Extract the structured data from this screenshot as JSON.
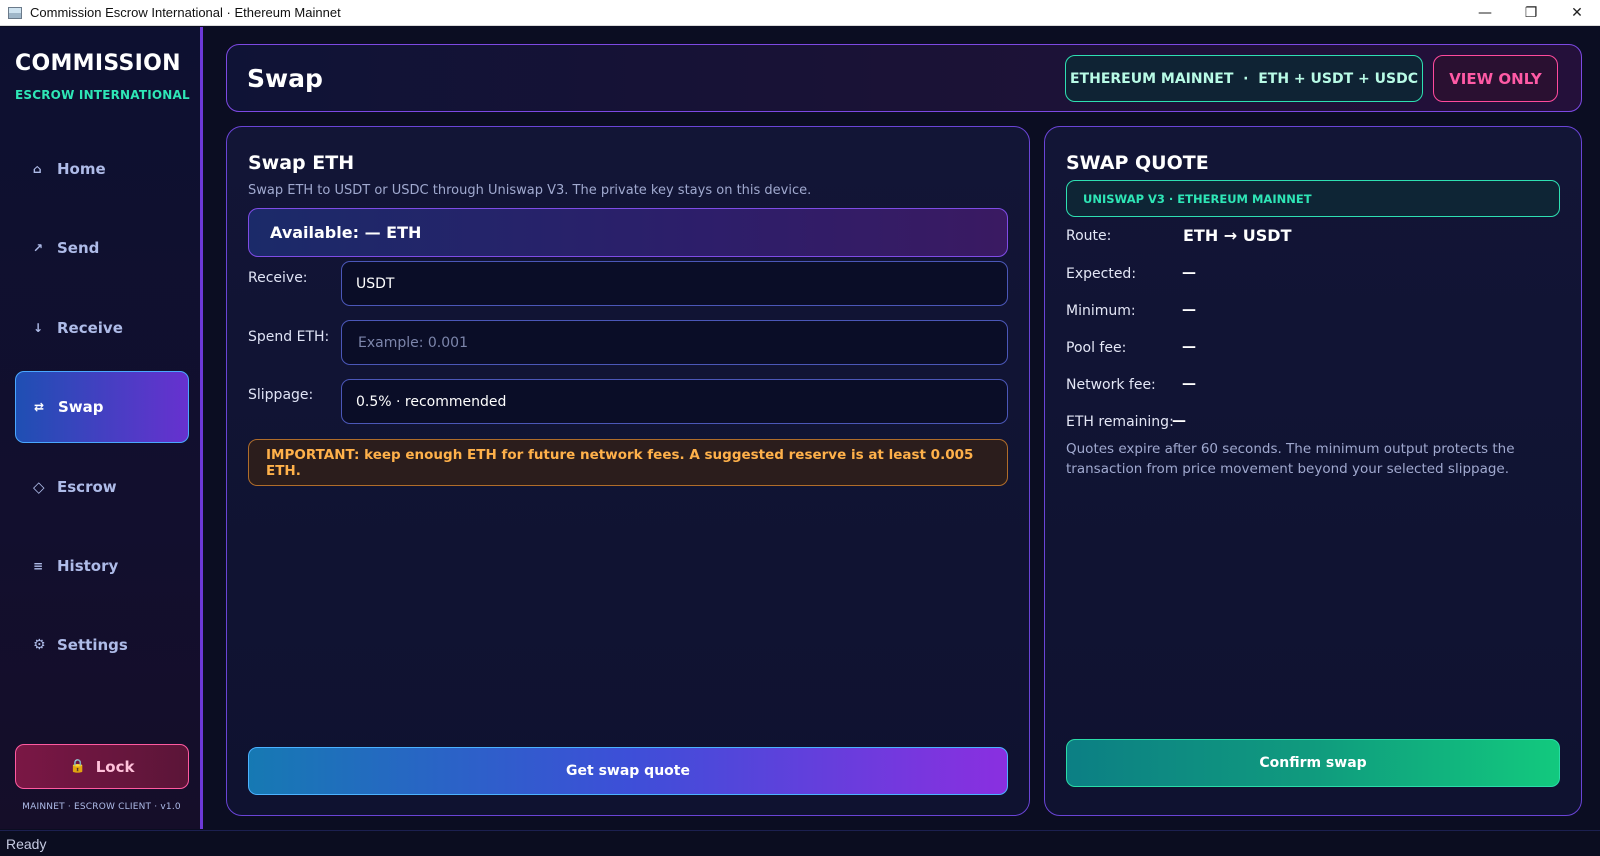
{
  "window": {
    "title": "Commission Escrow International · Ethereum Mainnet",
    "controls": {
      "minimize": "—",
      "maximize": "❐",
      "close": "✕"
    }
  },
  "sidebar": {
    "brand_title": "COMMISSION",
    "brand_subtitle": "ESCROW INTERNATIONAL",
    "items": [
      {
        "icon": "⌂",
        "icon_name": "home-icon",
        "label": "Home"
      },
      {
        "icon": "↗",
        "icon_name": "send-arrow-icon",
        "label": "Send"
      },
      {
        "icon": "↓",
        "icon_name": "receive-arrow-icon",
        "label": "Receive"
      },
      {
        "icon": "⇄",
        "icon_name": "swap-icon",
        "label": "Swap",
        "active": true
      },
      {
        "icon": "◇",
        "icon_name": "escrow-diamond-icon",
        "label": "Escrow"
      },
      {
        "icon": "≡",
        "icon_name": "history-list-icon",
        "label": "History"
      },
      {
        "icon": "⚙",
        "icon_name": "settings-gear-icon",
        "label": "Settings"
      }
    ],
    "lock_icon": "🔒",
    "lock_label": "Lock",
    "footer": "MAINNET · ESCROW CLIENT · v1.0"
  },
  "header": {
    "title": "Swap",
    "network_badge": "ETHEREUM MAINNET  ·  ETH + USDT + USDC",
    "mode_badge": "VIEW ONLY"
  },
  "swap": {
    "title": "Swap ETH",
    "description": "Swap ETH to USDT or USDC through Uniswap V3. The private key stays on this device.",
    "available": "Available: — ETH",
    "receive_label": "Receive:",
    "receive_value": "USDT",
    "spend_label": "Spend ETH:",
    "spend_placeholder": "Example: 0.001",
    "slippage_label": "Slippage:",
    "slippage_value": "0.5% · recommended",
    "warning": "IMPORTANT: keep enough ETH for future network fees. A suggested reserve is at least 0.005 ETH.",
    "quote_button": "Get swap quote"
  },
  "quote": {
    "title": "SWAP QUOTE",
    "route_badge": "UNISWAP V3 · ETHEREUM MAINNET",
    "rows": [
      {
        "label": "Route:",
        "value": "ETH → USDT"
      },
      {
        "label": "Expected:",
        "value": "—"
      },
      {
        "label": "Minimum:",
        "value": "—"
      },
      {
        "label": "Pool fee:",
        "value": "—"
      },
      {
        "label": "Network fee:",
        "value": "—"
      },
      {
        "label": "ETH remaining:",
        "value": "—"
      }
    ],
    "note": "Quotes expire after 60 seconds. The minimum output protects the transaction from price movement beyond your selected slippage.",
    "confirm_button": "Confirm swap"
  },
  "status": {
    "text": "Ready"
  },
  "colors": {
    "accent_purple": "#6d39d8",
    "accent_teal": "#2ee6b6",
    "warning_orange": "#ffb14a",
    "danger_pink": "#ff5aa5"
  }
}
